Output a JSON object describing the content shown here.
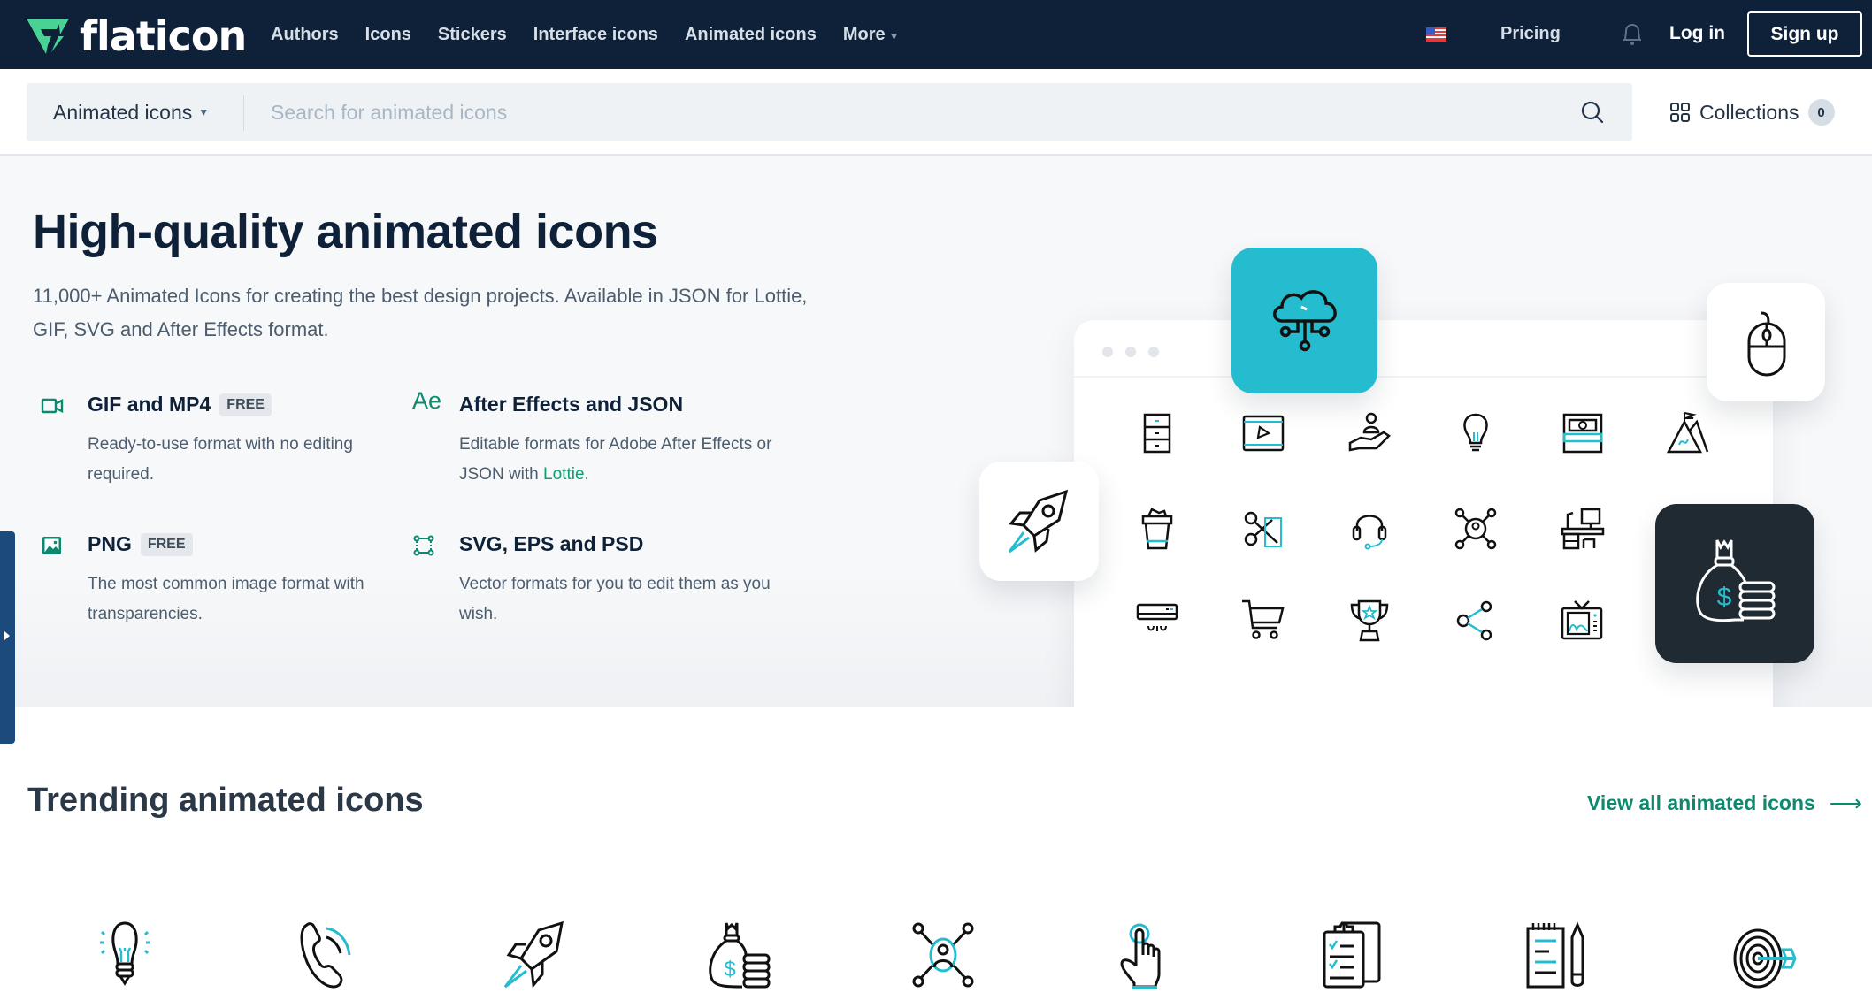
{
  "header": {
    "brand": "flaticon",
    "nav": [
      "Authors",
      "Icons",
      "Stickers",
      "Interface icons",
      "Animated icons",
      "More"
    ],
    "language_flag": "us-flag-icon",
    "pricing": "Pricing",
    "notifications_icon": "bell-icon",
    "login": "Log in",
    "signup": "Sign up"
  },
  "search": {
    "type_selected": "Animated icons",
    "placeholder": "Search for animated icons",
    "value": "",
    "search_icon": "search-icon"
  },
  "collections": {
    "label": "Collections",
    "count": "0"
  },
  "hero": {
    "title": "High-quality animated icons",
    "subtitle": "11,000+ Animated Icons for creating the best design projects. Available in JSON for Lottie, GIF, SVG and After Effects format.",
    "features": [
      {
        "icon": "video-camera-icon",
        "title": "GIF and MP4",
        "badge": "FREE",
        "desc": "Ready-to-use format with no editing required."
      },
      {
        "icon": "after-effects-icon",
        "icon_text": "Ae",
        "title": "After Effects and JSON",
        "badge": "",
        "desc_before": "Editable formats for Adobe After Effects or JSON with ",
        "desc_link": "Lottie",
        "desc_after": "."
      },
      {
        "icon": "image-icon",
        "title": "PNG",
        "badge": "FREE",
        "desc": "The most common image format with transparencies."
      },
      {
        "icon": "vector-nodes-icon",
        "title": "SVG, EPS and PSD",
        "badge": "",
        "desc": "Vector formats for you to edit them as you wish."
      }
    ],
    "illustration": {
      "grid_icons": [
        "cabinet-icon",
        "video-player-icon",
        "user-care-icon",
        "lightbulb-icon",
        "money-stack-icon",
        "mountain-flag-icon",
        "trash-bin-icon",
        "scissors-icon",
        "headset-icon",
        "network-user-icon",
        "workspace-desk-icon",
        "air-conditioner-icon",
        "shopping-cart-icon",
        "trophy-icon",
        "share-icon",
        "tv-icon"
      ],
      "feature_cards": [
        "cloud-network-icon",
        "computer-mouse-icon",
        "rocket-icon",
        "money-bag-icon"
      ]
    }
  },
  "trending": {
    "title": "Trending animated icons",
    "view_all": "View all animated icons",
    "icons": [
      "lightbulb-icon",
      "phone-call-icon",
      "rocket-icon",
      "money-bag-icon",
      "network-user-icon",
      "tap-hand-icon",
      "clipboard-checklist-icon",
      "notepad-pencil-icon",
      "target-arrow-icon"
    ]
  },
  "colors": {
    "header_bg": "#0e2139",
    "brand_green": "#4ad295",
    "accent_teal": "#26bccf",
    "link_green": "#0c8a6f",
    "dark_card": "#1f2a33",
    "side_tab": "#1c4a7d"
  }
}
